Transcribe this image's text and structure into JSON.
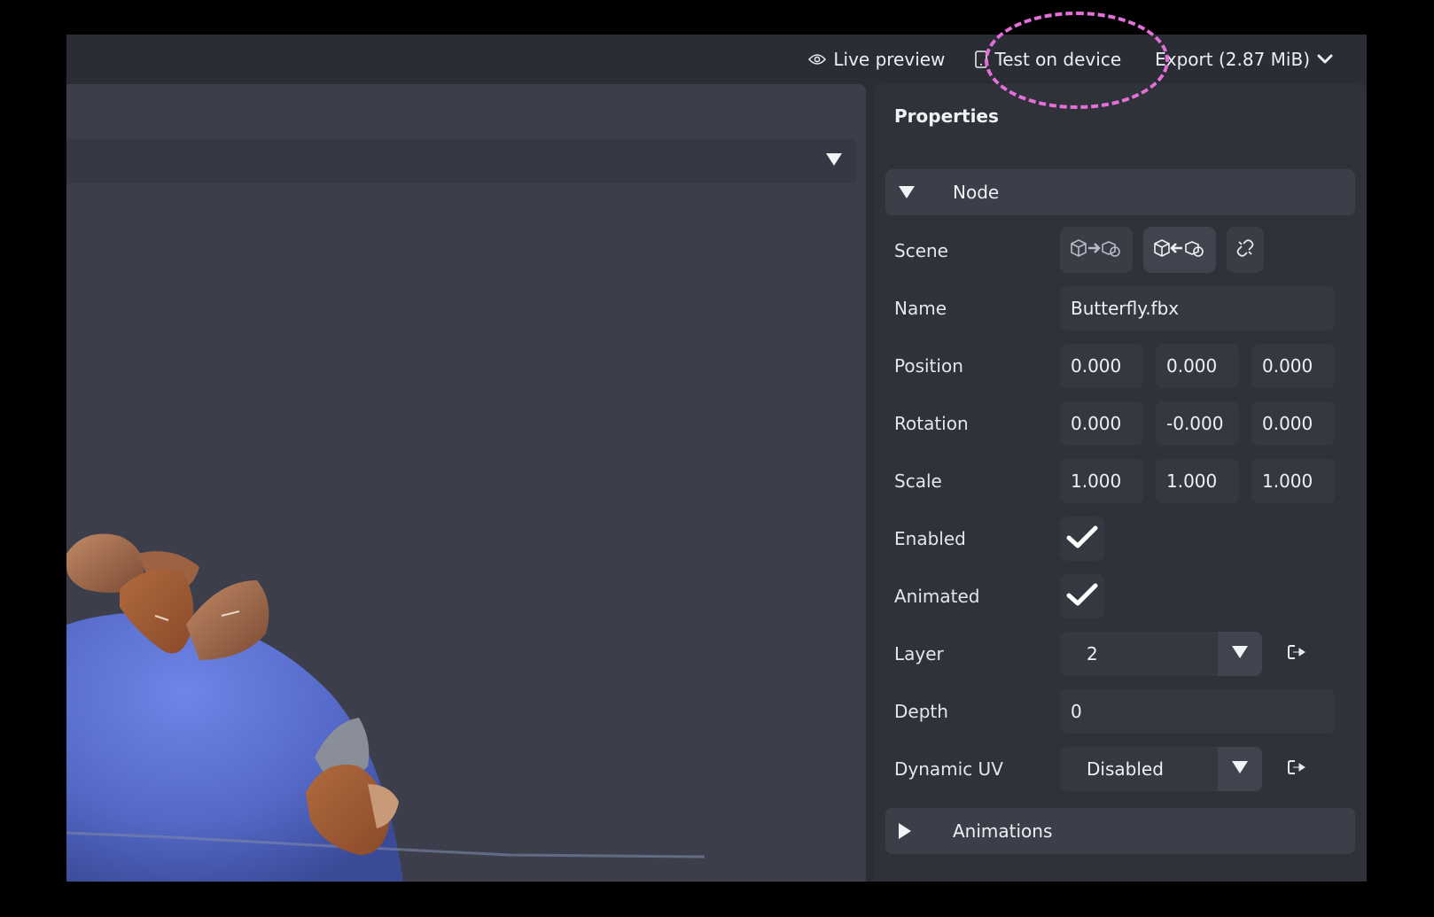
{
  "topbar": {
    "live_preview": "Live preview",
    "test_on_device": "Test on device",
    "export": "Export (2.87 MiB)"
  },
  "properties": {
    "title": "Properties",
    "node_section": "Node",
    "animations_section": "Animations",
    "rows": {
      "scene": "Scene",
      "name": "Name",
      "position": "Position",
      "rotation": "Rotation",
      "scale": "Scale",
      "enabled": "Enabled",
      "animated": "Animated",
      "layer": "Layer",
      "depth": "Depth",
      "dynamic_uv": "Dynamic UV"
    },
    "values": {
      "name": "Butterfly.fbx",
      "position": [
        "0.000",
        "0.000",
        "0.000"
      ],
      "rotation": [
        "0.000",
        "-0.000",
        "0.000"
      ],
      "scale": [
        "1.000",
        "1.000",
        "1.000"
      ],
      "enabled": true,
      "animated": true,
      "layer": "2",
      "depth": "0",
      "dynamic_uv": "Disabled"
    }
  },
  "colors": {
    "highlight": "#e46fd8",
    "viewport": "#3c3f4b",
    "panel": "#2f3239"
  },
  "icons": [
    "eye-icon",
    "phone-icon",
    "chevron-down-icon",
    "scene-export-icon",
    "scene-import-icon",
    "unlink-icon",
    "checkmark-icon",
    "triangle-down-icon",
    "triangle-right-icon",
    "external-link-icon"
  ]
}
